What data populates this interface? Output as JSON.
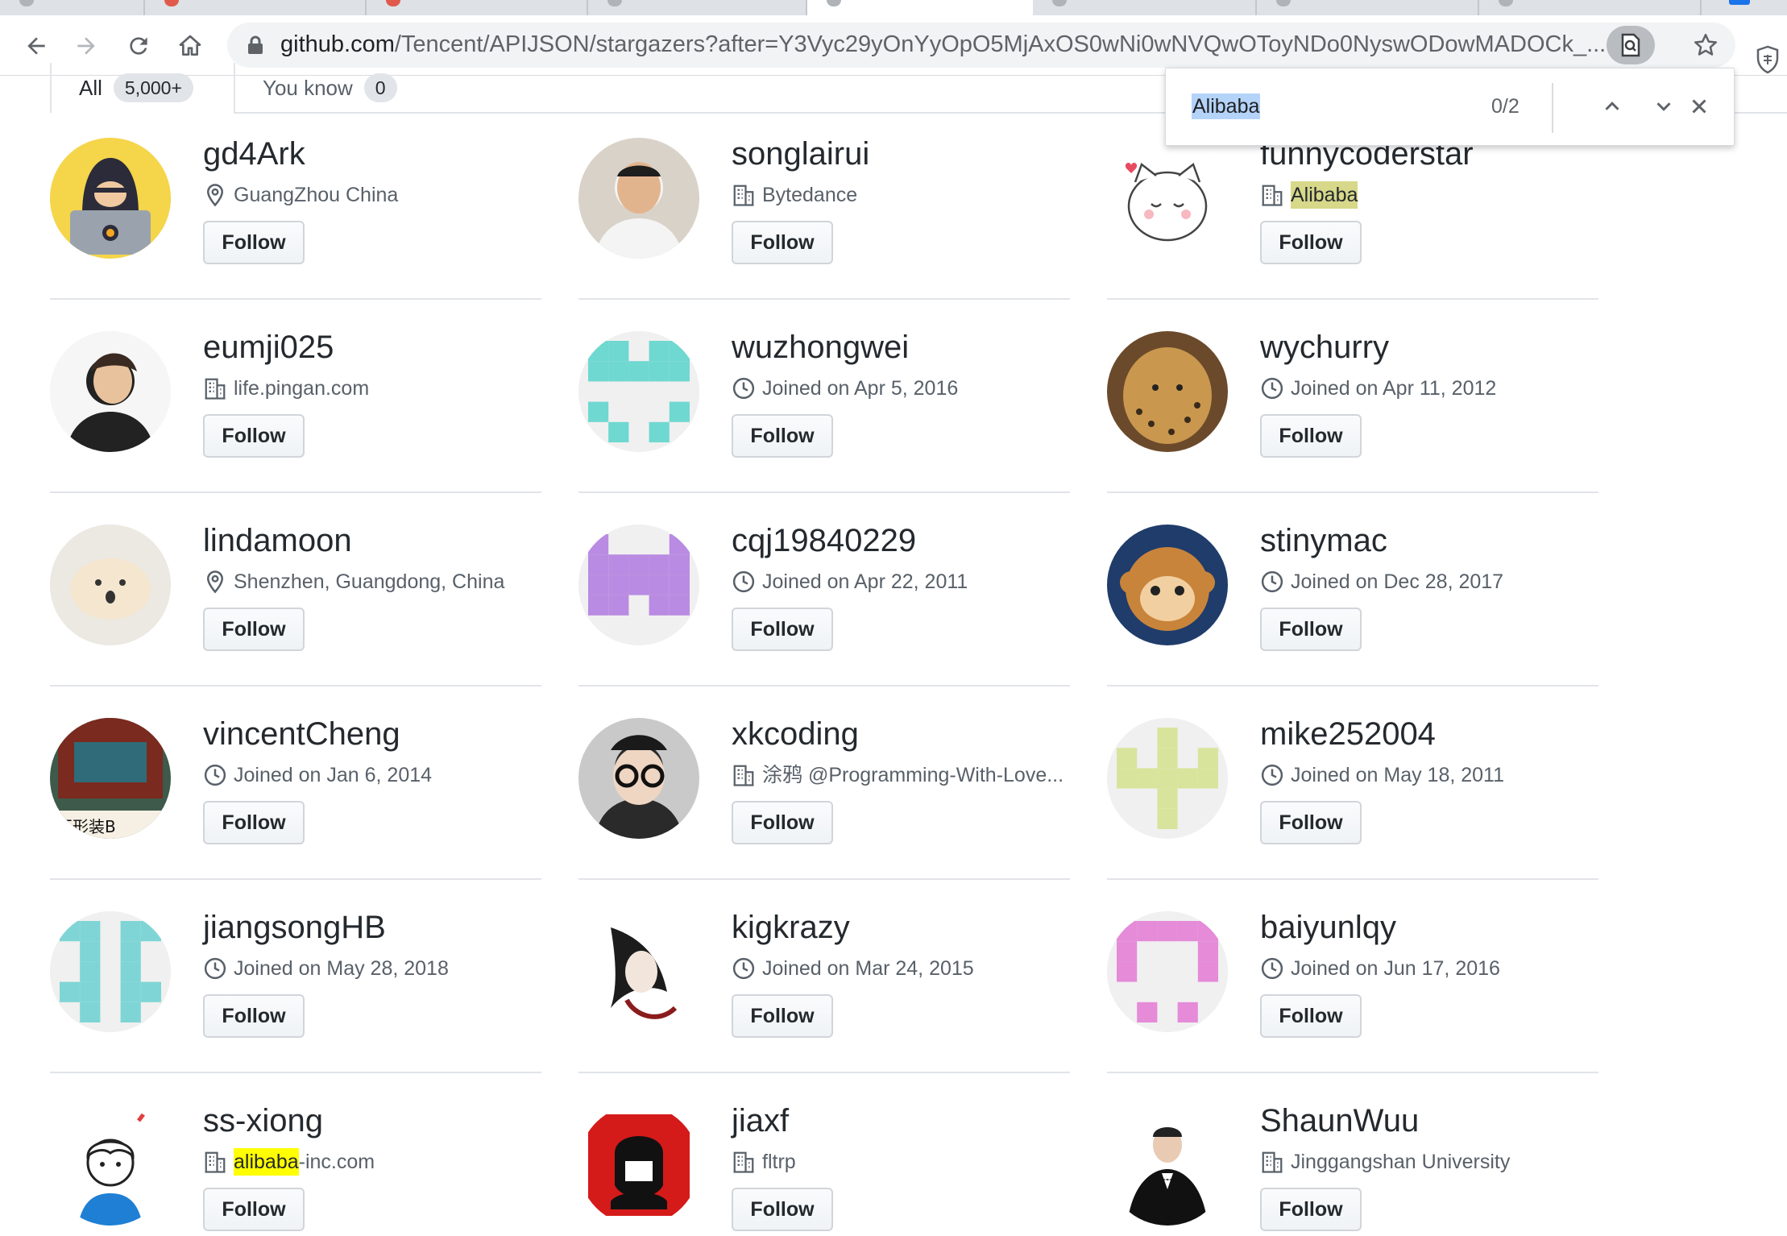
{
  "browser": {
    "url_host": "github.com",
    "url_path": "/Tencent/APIJSON/stargazers?after=Y3Vyc29yOnYyOpO5MjAxOS0wNi0wNVQwOToyNDo0NyswODowMADOCk_..."
  },
  "subnav": {
    "tabs": [
      {
        "label": "All",
        "count": "5,000+"
      },
      {
        "label": "You know",
        "count": "0"
      }
    ]
  },
  "findbar": {
    "query": "Alibaba",
    "count": "0/2"
  },
  "follow_label": "Follow",
  "users": [
    {
      "name": "gd4Ark",
      "meta_icon": "location-icon",
      "meta": "GuangZhou China"
    },
    {
      "name": "songlairui",
      "meta_icon": "organization-icon",
      "meta": "Bytedance"
    },
    {
      "name": "funnycoderstar",
      "meta_icon": "organization-icon",
      "meta": "Alibaba"
    },
    {
      "name": "eumji025",
      "meta_icon": "organization-icon",
      "meta": "life.pingan.com"
    },
    {
      "name": "wuzhongwei",
      "meta_icon": "clock-icon",
      "meta": "Joined on Apr 5, 2016"
    },
    {
      "name": "wychurry",
      "meta_icon": "clock-icon",
      "meta": "Joined on Apr 11, 2012"
    },
    {
      "name": "lindamoon",
      "meta_icon": "location-icon",
      "meta": "Shenzhen, Guangdong, China"
    },
    {
      "name": "cqj19840229",
      "meta_icon": "clock-icon",
      "meta": "Joined on Apr 22, 2011"
    },
    {
      "name": "stinymac",
      "meta_icon": "clock-icon",
      "meta": "Joined on Dec 28, 2017"
    },
    {
      "name": "vincentCheng",
      "meta_icon": "clock-icon",
      "meta": "Joined on Jan 6, 2014"
    },
    {
      "name": "xkcoding",
      "meta_icon": "organization-icon",
      "meta": "涂鸦 @Programming-With-Love..."
    },
    {
      "name": "mike252004",
      "meta_icon": "clock-icon",
      "meta": "Joined on May 18, 2011"
    },
    {
      "name": "jiangsongHB",
      "meta_icon": "clock-icon",
      "meta": "Joined on May 28, 2018"
    },
    {
      "name": "kigkrazy",
      "meta_icon": "clock-icon",
      "meta": "Joined on Mar 24, 2015"
    },
    {
      "name": "baiyunlqy",
      "meta_icon": "clock-icon",
      "meta": "Joined on Jun 17, 2016"
    },
    {
      "name": "ss-xiong",
      "meta_icon": "organization-icon",
      "meta_hl": "alibaba",
      "meta_rest": "-inc.com"
    },
    {
      "name": "jiaxf",
      "meta_icon": "organization-icon",
      "meta": "fltrp"
    },
    {
      "name": "ShaunWuu",
      "meta_icon": "organization-icon",
      "meta": "Jinggangshan University"
    }
  ],
  "colors": {
    "find_highlight_active": "#ffff00",
    "find_highlight_other": "#d7d889",
    "find_query_selection": "#b4d3f9",
    "identicon_teal": "#6fd8d0",
    "identicon_purple": "#b98be2",
    "identicon_lime": "#d8e49c",
    "identicon_cyan": "#7fd5d5",
    "identicon_pink": "#e58bd8"
  }
}
